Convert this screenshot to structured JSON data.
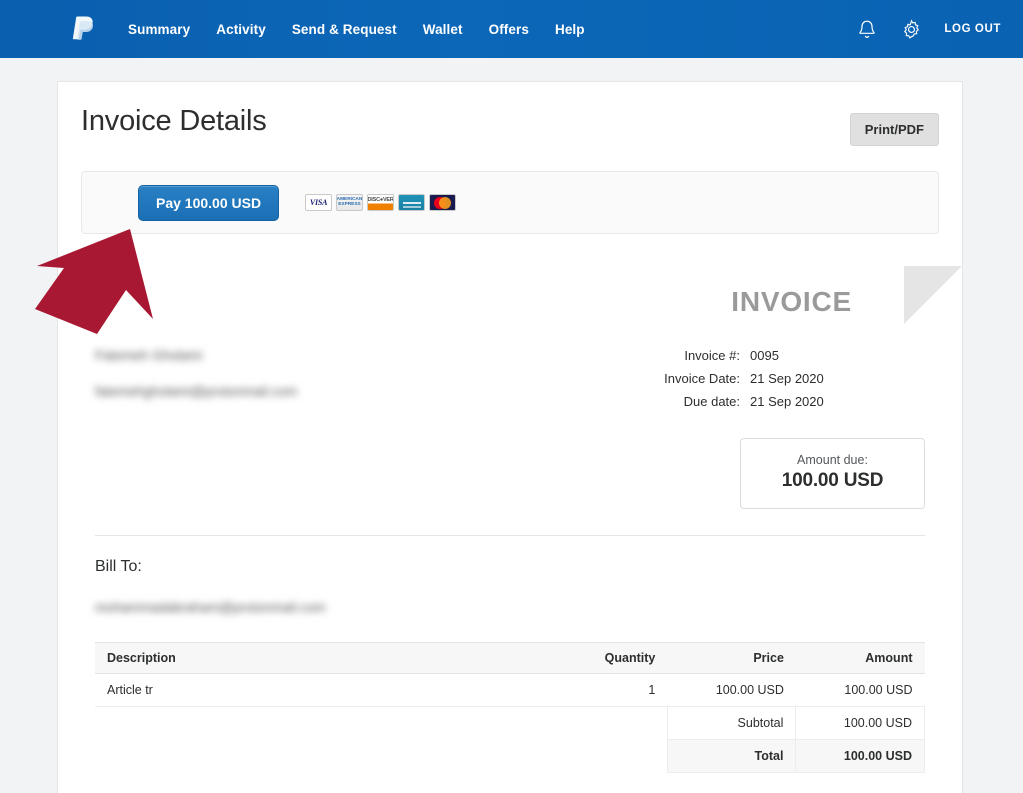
{
  "nav": {
    "logo_name": "paypal-logo",
    "items": [
      {
        "label": "Summary",
        "name": "nav-item-summary"
      },
      {
        "label": "Activity",
        "name": "nav-item-activity"
      },
      {
        "label": "Send & Request",
        "name": "nav-item-send-request"
      },
      {
        "label": "Wallet",
        "name": "nav-item-wallet"
      },
      {
        "label": "Offers",
        "name": "nav-item-offers"
      },
      {
        "label": "Help",
        "name": "nav-item-help"
      }
    ],
    "bell_icon": "bell-icon",
    "gear_icon": "gear-icon",
    "logout_label": "LOG OUT",
    "bar_color": "#0c66b5"
  },
  "page": {
    "title": "Invoice Details",
    "print_button": "Print/PDF",
    "background": "#f2f3f5"
  },
  "payment": {
    "pay_button_label": "Pay 100.00 USD",
    "pay_button_color": "#1f73ba",
    "cards": [
      {
        "name": "visa-card-icon",
        "label": "VISA"
      },
      {
        "name": "amex-card-icon",
        "label": "AMERICAN EXPRESS"
      },
      {
        "name": "discover-card-icon",
        "label": "DISCOVER"
      },
      {
        "name": "bank-card-icon",
        "label": ""
      },
      {
        "name": "mastercard-card-icon",
        "label": ""
      }
    ]
  },
  "invoice": {
    "heading": "INVOICE",
    "merchant_name_redacted": "Fatemeh Gholami",
    "merchant_email_redacted": "fatemehgholami@protonmail.com",
    "meta": [
      {
        "label": "Invoice #:",
        "value": "0095"
      },
      {
        "label": "Invoice Date:",
        "value": "21 Sep 2020"
      },
      {
        "label": "Due date:",
        "value": "21 Sep 2020"
      }
    ],
    "amount_due_label": "Amount due:",
    "amount_due_value": "100.00 USD",
    "bill_to_label": "Bill To:",
    "bill_to_value_redacted": "mohammadabraham@protonmail.com"
  },
  "table": {
    "headers": {
      "description": "Description",
      "quantity": "Quantity",
      "price": "Price",
      "amount": "Amount"
    },
    "rows": [
      {
        "description": "Article tr",
        "quantity": "1",
        "price": "100.00 USD",
        "amount": "100.00 USD"
      }
    ],
    "subtotal_label": "Subtotal",
    "subtotal_value": "100.00 USD",
    "total_label": "Total",
    "total_value": "100.00 USD"
  },
  "annotation": {
    "arrow_name": "red-arrow-pointing-to-pay-button",
    "arrow_color": "#a81832"
  }
}
